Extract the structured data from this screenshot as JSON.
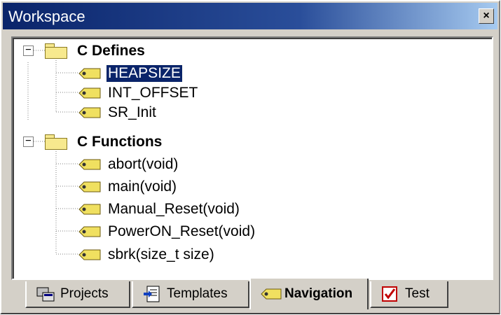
{
  "window": {
    "title": "Workspace",
    "close_glyph": "×"
  },
  "tree": {
    "groups": [
      {
        "label": "C Defines",
        "expander": "−",
        "items": [
          "HEAPSIZE",
          "INT_OFFSET",
          "SR_Init"
        ]
      },
      {
        "label": "C Functions",
        "expander": "−",
        "items": [
          "abort(void)",
          "main(void)",
          "Manual_Reset(void)",
          "PowerON_Reset(void)",
          "sbrk(size_t size)"
        ]
      }
    ],
    "selected": "HEAPSIZE"
  },
  "tabs": [
    {
      "label": "Projects",
      "icon": "projects-icon"
    },
    {
      "label": "Templates",
      "icon": "templates-icon"
    },
    {
      "label": "Navigation",
      "icon": "navigation-tag-icon",
      "active": true
    },
    {
      "label": "Test",
      "icon": "test-checklist-icon"
    }
  ],
  "colors": {
    "title_bar": "#0a246a",
    "selection": "#0a246a",
    "folder": "#f7e98e",
    "tag": "#f0e060"
  }
}
